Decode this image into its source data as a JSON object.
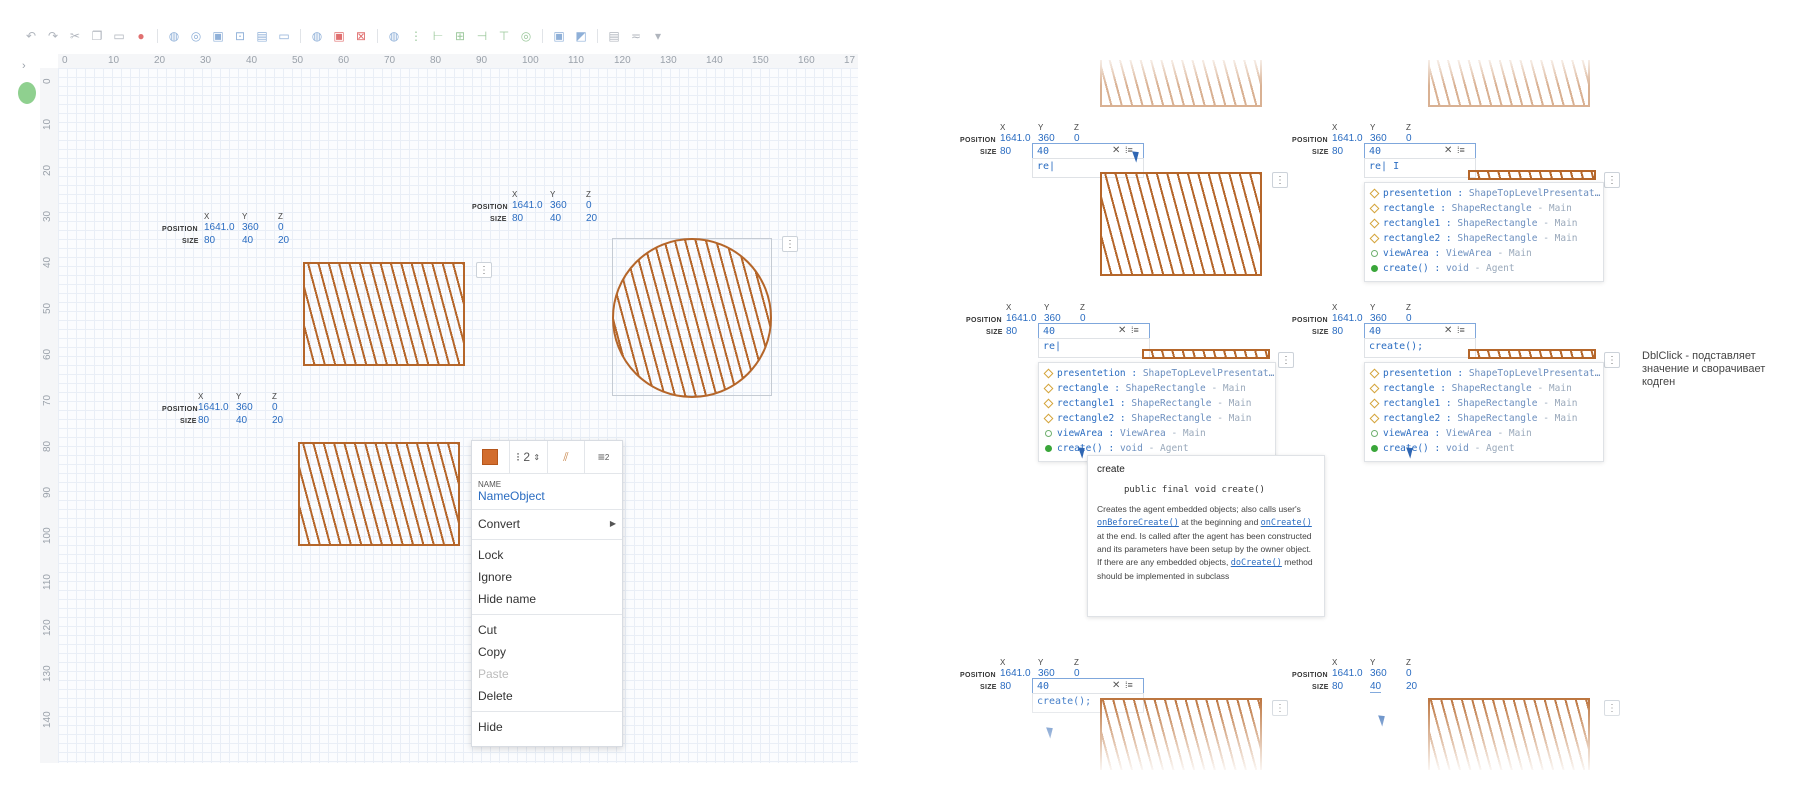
{
  "ruler": {
    "top": [
      "0",
      "10",
      "20",
      "30",
      "40",
      "50",
      "60",
      "70",
      "80",
      "90",
      "100",
      "110",
      "120",
      "130",
      "140",
      "150",
      "160",
      "17"
    ],
    "left": [
      "0",
      "10",
      "20",
      "30",
      "40",
      "50",
      "60",
      "70",
      "80",
      "90",
      "100",
      "110",
      "120",
      "130",
      "140"
    ]
  },
  "props": {
    "pos_label": "POSITION",
    "size_label": "SIZE",
    "x": "X",
    "y": "Y",
    "z": "Z",
    "px": "1641.0",
    "py": "360",
    "pz": "0",
    "sx": "80",
    "sy": "40",
    "sz": "20"
  },
  "context_menu": {
    "count": "2",
    "superscript": "2",
    "name_label": "NAME",
    "name_value": "NameObject",
    "items": [
      "Convert",
      "Lock",
      "Ignore",
      "Hide name",
      "Cut",
      "Copy",
      "Paste",
      "Delete",
      "Hide"
    ]
  },
  "autocomplete": {
    "typed": "re",
    "filled": "create();",
    "items": [
      {
        "name": "presentetion",
        "type": "ShapeTopLevelPresentat…",
        "kind": "field"
      },
      {
        "name": "rectangle",
        "type": "ShapeRectangle",
        "scope": "Main",
        "kind": "field"
      },
      {
        "name": "rectangle1",
        "type": "ShapeRectangle",
        "scope": "Main",
        "kind": "field"
      },
      {
        "name": "rectangle2",
        "type": "ShapeRectangle",
        "scope": "Main",
        "kind": "field"
      },
      {
        "name": "viewArea",
        "type": "ViewArea",
        "scope": "Main",
        "kind": "var"
      },
      {
        "name": "create()",
        "type": "void",
        "scope": "Agent",
        "kind": "method"
      }
    ]
  },
  "doc": {
    "title": "create",
    "signature": "public final void create()",
    "p1a": "Creates the agent embedded objects; also calls user's ",
    "link1": "onBeforeCreate()",
    "p1b": " at the beginning and ",
    "link2": "onCreate()",
    "p1c": " at the end. Is called after the agent has been constructed and its parameters have been setup by the owner object.",
    "p2a": "If there are any embedded objects, ",
    "link3": "doCreate()",
    "p2b": " method should be implemented in subclass"
  },
  "note": "DblClick - подставляет значение  и сворачивает кодген",
  "colors": {
    "shape": "#b5662a",
    "accent": "#2a6cc1"
  }
}
